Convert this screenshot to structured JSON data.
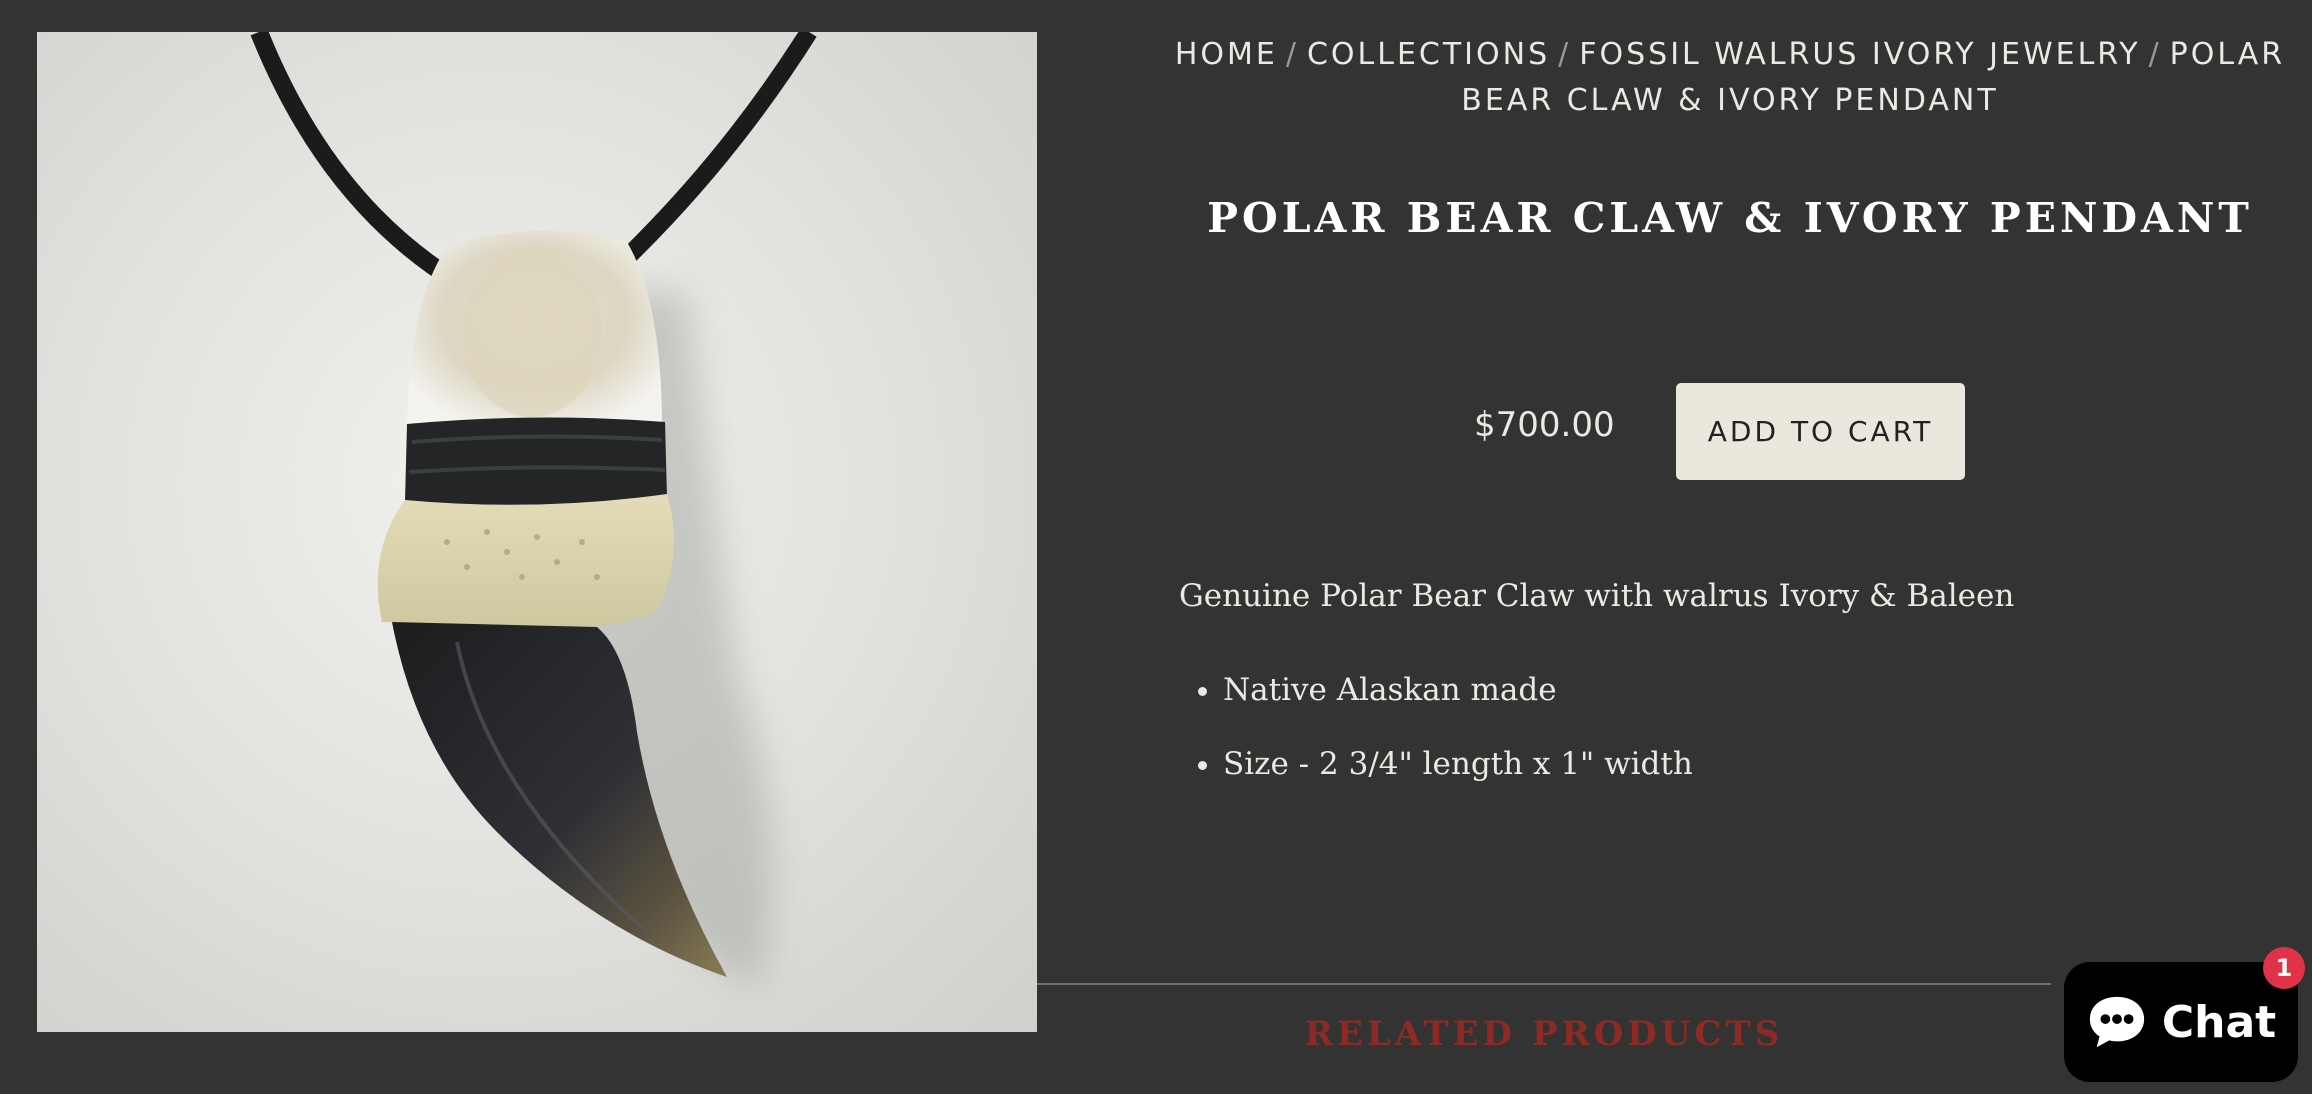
{
  "breadcrumb": {
    "items": [
      "HOME",
      "COLLECTIONS",
      "FOSSIL WALRUS IVORY JEWELRY",
      "POLAR BEAR CLAW & IVORY PENDANT"
    ],
    "separator": "/"
  },
  "product": {
    "title": "POLAR BEAR CLAW & IVORY PENDANT",
    "price": "$700.00",
    "add_to_cart_label": "ADD TO CART",
    "image_icon": "pendant-product-photo",
    "description": {
      "intro": "Genuine Polar Bear Claw with walrus Ivory & Baleen",
      "bullets": [
        "Native Alaskan made",
        "Size - 2 3/4\" length x 1\" width"
      ]
    }
  },
  "related": {
    "title": "RELATED PRODUCTS"
  },
  "chat": {
    "label": "Chat",
    "badge_count": "1",
    "icon": "chat-bubble-icon"
  },
  "colors": {
    "background": "#333333",
    "text": "#ece9e2",
    "cart_button": "#ece7dc",
    "related_title": "#8e2a26",
    "chat_badge": "#e0334a"
  }
}
